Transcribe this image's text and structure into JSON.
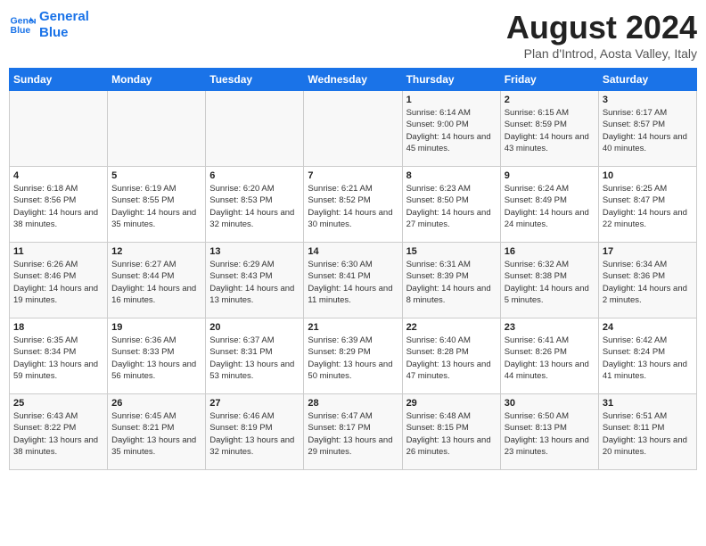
{
  "header": {
    "logo_line1": "General",
    "logo_line2": "Blue",
    "title": "August 2024",
    "subtitle": "Plan d'Introd, Aosta Valley, Italy"
  },
  "weekdays": [
    "Sunday",
    "Monday",
    "Tuesday",
    "Wednesday",
    "Thursday",
    "Friday",
    "Saturday"
  ],
  "weeks": [
    [
      {
        "day": "",
        "info": ""
      },
      {
        "day": "",
        "info": ""
      },
      {
        "day": "",
        "info": ""
      },
      {
        "day": "",
        "info": ""
      },
      {
        "day": "1",
        "info": "Sunrise: 6:14 AM\nSunset: 9:00 PM\nDaylight: 14 hours\nand 45 minutes."
      },
      {
        "day": "2",
        "info": "Sunrise: 6:15 AM\nSunset: 8:59 PM\nDaylight: 14 hours\nand 43 minutes."
      },
      {
        "day": "3",
        "info": "Sunrise: 6:17 AM\nSunset: 8:57 PM\nDaylight: 14 hours\nand 40 minutes."
      }
    ],
    [
      {
        "day": "4",
        "info": "Sunrise: 6:18 AM\nSunset: 8:56 PM\nDaylight: 14 hours\nand 38 minutes."
      },
      {
        "day": "5",
        "info": "Sunrise: 6:19 AM\nSunset: 8:55 PM\nDaylight: 14 hours\nand 35 minutes."
      },
      {
        "day": "6",
        "info": "Sunrise: 6:20 AM\nSunset: 8:53 PM\nDaylight: 14 hours\nand 32 minutes."
      },
      {
        "day": "7",
        "info": "Sunrise: 6:21 AM\nSunset: 8:52 PM\nDaylight: 14 hours\nand 30 minutes."
      },
      {
        "day": "8",
        "info": "Sunrise: 6:23 AM\nSunset: 8:50 PM\nDaylight: 14 hours\nand 27 minutes."
      },
      {
        "day": "9",
        "info": "Sunrise: 6:24 AM\nSunset: 8:49 PM\nDaylight: 14 hours\nand 24 minutes."
      },
      {
        "day": "10",
        "info": "Sunrise: 6:25 AM\nSunset: 8:47 PM\nDaylight: 14 hours\nand 22 minutes."
      }
    ],
    [
      {
        "day": "11",
        "info": "Sunrise: 6:26 AM\nSunset: 8:46 PM\nDaylight: 14 hours\nand 19 minutes."
      },
      {
        "day": "12",
        "info": "Sunrise: 6:27 AM\nSunset: 8:44 PM\nDaylight: 14 hours\nand 16 minutes."
      },
      {
        "day": "13",
        "info": "Sunrise: 6:29 AM\nSunset: 8:43 PM\nDaylight: 14 hours\nand 13 minutes."
      },
      {
        "day": "14",
        "info": "Sunrise: 6:30 AM\nSunset: 8:41 PM\nDaylight: 14 hours\nand 11 minutes."
      },
      {
        "day": "15",
        "info": "Sunrise: 6:31 AM\nSunset: 8:39 PM\nDaylight: 14 hours\nand 8 minutes."
      },
      {
        "day": "16",
        "info": "Sunrise: 6:32 AM\nSunset: 8:38 PM\nDaylight: 14 hours\nand 5 minutes."
      },
      {
        "day": "17",
        "info": "Sunrise: 6:34 AM\nSunset: 8:36 PM\nDaylight: 14 hours\nand 2 minutes."
      }
    ],
    [
      {
        "day": "18",
        "info": "Sunrise: 6:35 AM\nSunset: 8:34 PM\nDaylight: 13 hours\nand 59 minutes."
      },
      {
        "day": "19",
        "info": "Sunrise: 6:36 AM\nSunset: 8:33 PM\nDaylight: 13 hours\nand 56 minutes."
      },
      {
        "day": "20",
        "info": "Sunrise: 6:37 AM\nSunset: 8:31 PM\nDaylight: 13 hours\nand 53 minutes."
      },
      {
        "day": "21",
        "info": "Sunrise: 6:39 AM\nSunset: 8:29 PM\nDaylight: 13 hours\nand 50 minutes."
      },
      {
        "day": "22",
        "info": "Sunrise: 6:40 AM\nSunset: 8:28 PM\nDaylight: 13 hours\nand 47 minutes."
      },
      {
        "day": "23",
        "info": "Sunrise: 6:41 AM\nSunset: 8:26 PM\nDaylight: 13 hours\nand 44 minutes."
      },
      {
        "day": "24",
        "info": "Sunrise: 6:42 AM\nSunset: 8:24 PM\nDaylight: 13 hours\nand 41 minutes."
      }
    ],
    [
      {
        "day": "25",
        "info": "Sunrise: 6:43 AM\nSunset: 8:22 PM\nDaylight: 13 hours\nand 38 minutes."
      },
      {
        "day": "26",
        "info": "Sunrise: 6:45 AM\nSunset: 8:21 PM\nDaylight: 13 hours\nand 35 minutes."
      },
      {
        "day": "27",
        "info": "Sunrise: 6:46 AM\nSunset: 8:19 PM\nDaylight: 13 hours\nand 32 minutes."
      },
      {
        "day": "28",
        "info": "Sunrise: 6:47 AM\nSunset: 8:17 PM\nDaylight: 13 hours\nand 29 minutes."
      },
      {
        "day": "29",
        "info": "Sunrise: 6:48 AM\nSunset: 8:15 PM\nDaylight: 13 hours\nand 26 minutes."
      },
      {
        "day": "30",
        "info": "Sunrise: 6:50 AM\nSunset: 8:13 PM\nDaylight: 13 hours\nand 23 minutes."
      },
      {
        "day": "31",
        "info": "Sunrise: 6:51 AM\nSunset: 8:11 PM\nDaylight: 13 hours\nand 20 minutes."
      }
    ]
  ]
}
